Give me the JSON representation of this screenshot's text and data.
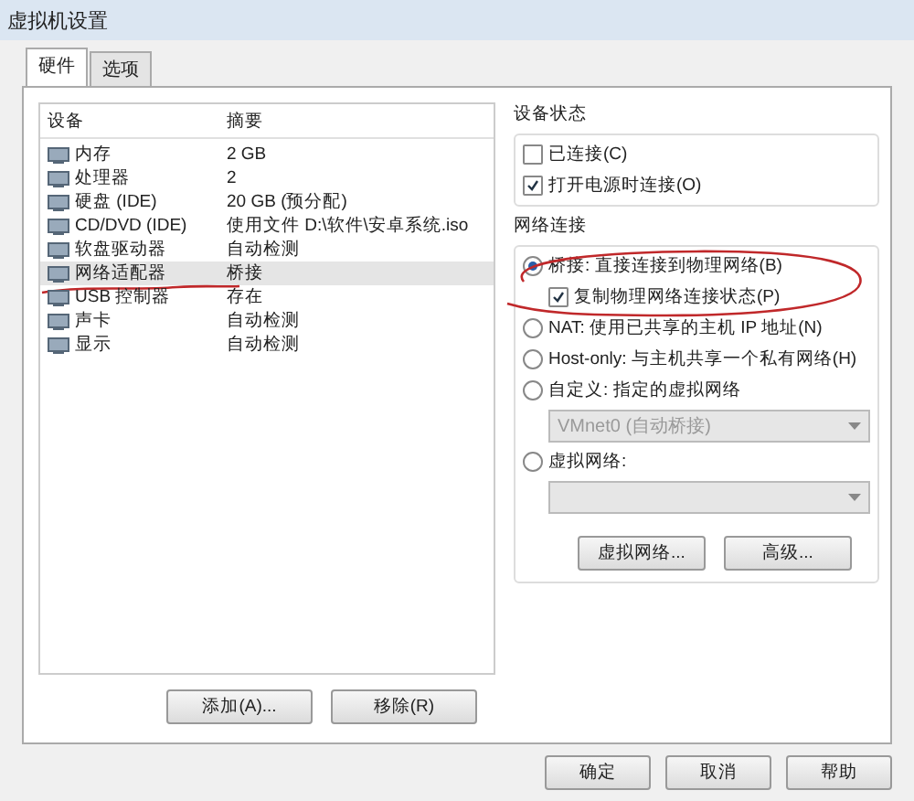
{
  "window": {
    "title": "虚拟机设置"
  },
  "tabs": [
    {
      "label": "硬件",
      "selected": true
    },
    {
      "label": "选项",
      "selected": false
    }
  ],
  "devices": {
    "columns": [
      "设备",
      "摘要"
    ],
    "rows": [
      {
        "device": "内存",
        "summary": "2 GB",
        "selected": false
      },
      {
        "device": "处理器",
        "summary": "2",
        "selected": false
      },
      {
        "device": "硬盘 (IDE)",
        "summary": "20 GB (预分配)",
        "selected": false
      },
      {
        "device": "CD/DVD (IDE)",
        "summary": "使用文件 D:\\软件\\安卓系统.iso",
        "selected": false
      },
      {
        "device": "软盘驱动器",
        "summary": "自动检测",
        "selected": false
      },
      {
        "device": "网络适配器",
        "summary": "桥接",
        "selected": true
      },
      {
        "device": "USB 控制器",
        "summary": "存在",
        "selected": false
      },
      {
        "device": "声卡",
        "summary": "自动检测",
        "selected": false
      },
      {
        "device": "显示",
        "summary": "自动检测",
        "selected": false
      }
    ]
  },
  "device_buttons": [
    "添加(A)...",
    "移除(R)"
  ],
  "device_status": {
    "title": "设备状态",
    "options": [
      {
        "label": "已连接(C)",
        "checked": false
      },
      {
        "label": "打开电源时连接(O)",
        "checked": true
      }
    ]
  },
  "network": {
    "title": "网络连接",
    "options": [
      {
        "kind": "radio",
        "label": "桥接: 直接连接到物理网络(B)",
        "selected": true
      },
      {
        "kind": "check",
        "label": "复制物理网络连接状态(P)",
        "checked": true
      },
      {
        "kind": "radio",
        "label": "NAT: 使用已共享的主机 IP 地址(N)",
        "selected": false
      },
      {
        "kind": "radio",
        "label": "Host-only: 与主机共享一个私有网络(H)",
        "selected": false
      },
      {
        "kind": "radio",
        "label": "自定义: 指定的虚拟网络",
        "selected": false
      },
      {
        "kind": "select",
        "value": "VMnet0 (自动桥接)",
        "disabled": true
      },
      {
        "kind": "radio",
        "label": "虚拟网络:",
        "selected": false
      },
      {
        "kind": "select",
        "disabled": true
      }
    ],
    "buttons": [
      "虚拟网络...",
      "高级..."
    ]
  },
  "dialog_buttons": [
    "确定",
    "取消",
    "帮助"
  ]
}
